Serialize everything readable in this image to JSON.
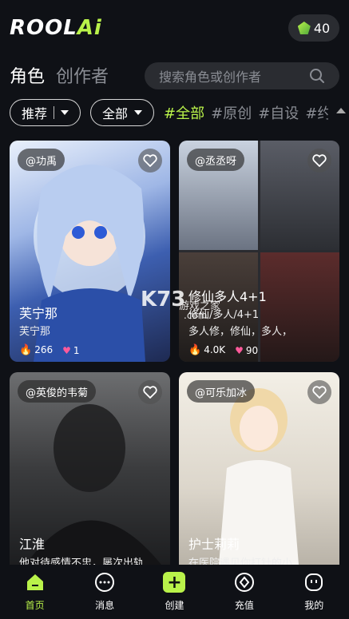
{
  "header": {
    "logo_main": "ROOL",
    "logo_ai": "Ai",
    "coins": "40"
  },
  "tabs": [
    {
      "label": "角色"
    },
    {
      "label": "创作者"
    }
  ],
  "search": {
    "placeholder": "搜索角色或创作者"
  },
  "filters": {
    "sort_label": "推荐",
    "category_label": "全部",
    "tags": [
      "#全部",
      "#原创",
      "#自设",
      "#约"
    ]
  },
  "cards": [
    {
      "author": "@功禹",
      "name": "芙宁那",
      "subtitle": "芙宁那",
      "hot": "266",
      "likes": "1"
    },
    {
      "author": "@丞丞呀",
      "name": "修仙多人4+1",
      "subtitle": "修仙/多人/4+1",
      "desc": "多人修，修仙，多人，",
      "hot": "4.0K",
      "likes": "90"
    },
    {
      "author": "@英俊的韦菊",
      "name": "江淮",
      "subtitle": "他对待感情不忠，屡次出轨"
    },
    {
      "author": "@可乐加冰",
      "name": "护士莉莉",
      "subtitle": "在医院遇见你打针的小"
    }
  ],
  "watermark": {
    "brand": "K73",
    "sub": "游戏之家",
    "domain": ".com"
  },
  "nav": [
    {
      "label": "首页",
      "icon": "home-icon"
    },
    {
      "label": "消息",
      "icon": "message-icon"
    },
    {
      "label": "创建",
      "icon": "plus-icon"
    },
    {
      "label": "充值",
      "icon": "diamond-icon"
    },
    {
      "label": "我的",
      "icon": "profile-icon"
    }
  ],
  "colors": {
    "accent": "#b9f24a",
    "background": "#0f1116",
    "hot": "#ff8a1a",
    "like": "#ff5a9b"
  }
}
